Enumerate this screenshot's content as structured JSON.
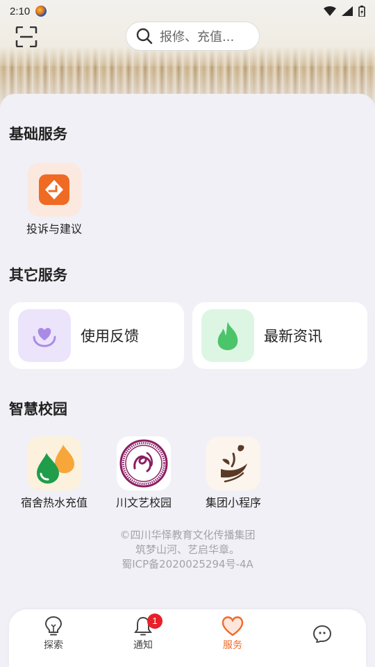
{
  "status_bar": {
    "time": "2:10"
  },
  "search": {
    "placeholder": "报修、充值..."
  },
  "sections": {
    "basic": {
      "title": "基础服务",
      "items": [
        {
          "label": "投诉与建议",
          "icon": "complaint-icon"
        }
      ]
    },
    "other": {
      "title": "其它服务",
      "cards": [
        {
          "label": "使用反馈",
          "icon": "feedback-heart-icon"
        },
        {
          "label": "最新资讯",
          "icon": "fire-icon"
        }
      ]
    },
    "campus": {
      "title": "智慧校园",
      "items": [
        {
          "label": "宿舍热水充值",
          "icon": "water-drops-icon"
        },
        {
          "label": "川文艺校园",
          "icon": "university-seal-icon"
        },
        {
          "label": "集团小程序",
          "icon": "group-logo-icon"
        }
      ]
    }
  },
  "footer": {
    "line1": "©四川华怿教育文化传播集团",
    "line2": "筑梦山河、艺启华章。",
    "line3": "蜀ICP备2020025294号-4A"
  },
  "tabbar": {
    "tabs": [
      {
        "label": "探索",
        "icon": "lightbulb-icon"
      },
      {
        "label": "通知",
        "icon": "bell-icon",
        "badge": "1"
      },
      {
        "label": "服务",
        "icon": "heart-icon",
        "active": true
      },
      {
        "label": "",
        "icon": "chat-bubble-icon"
      }
    ]
  },
  "colors": {
    "accent": "#ef6a2b",
    "badge": "#e8202a",
    "background": "#f1f0f6"
  }
}
